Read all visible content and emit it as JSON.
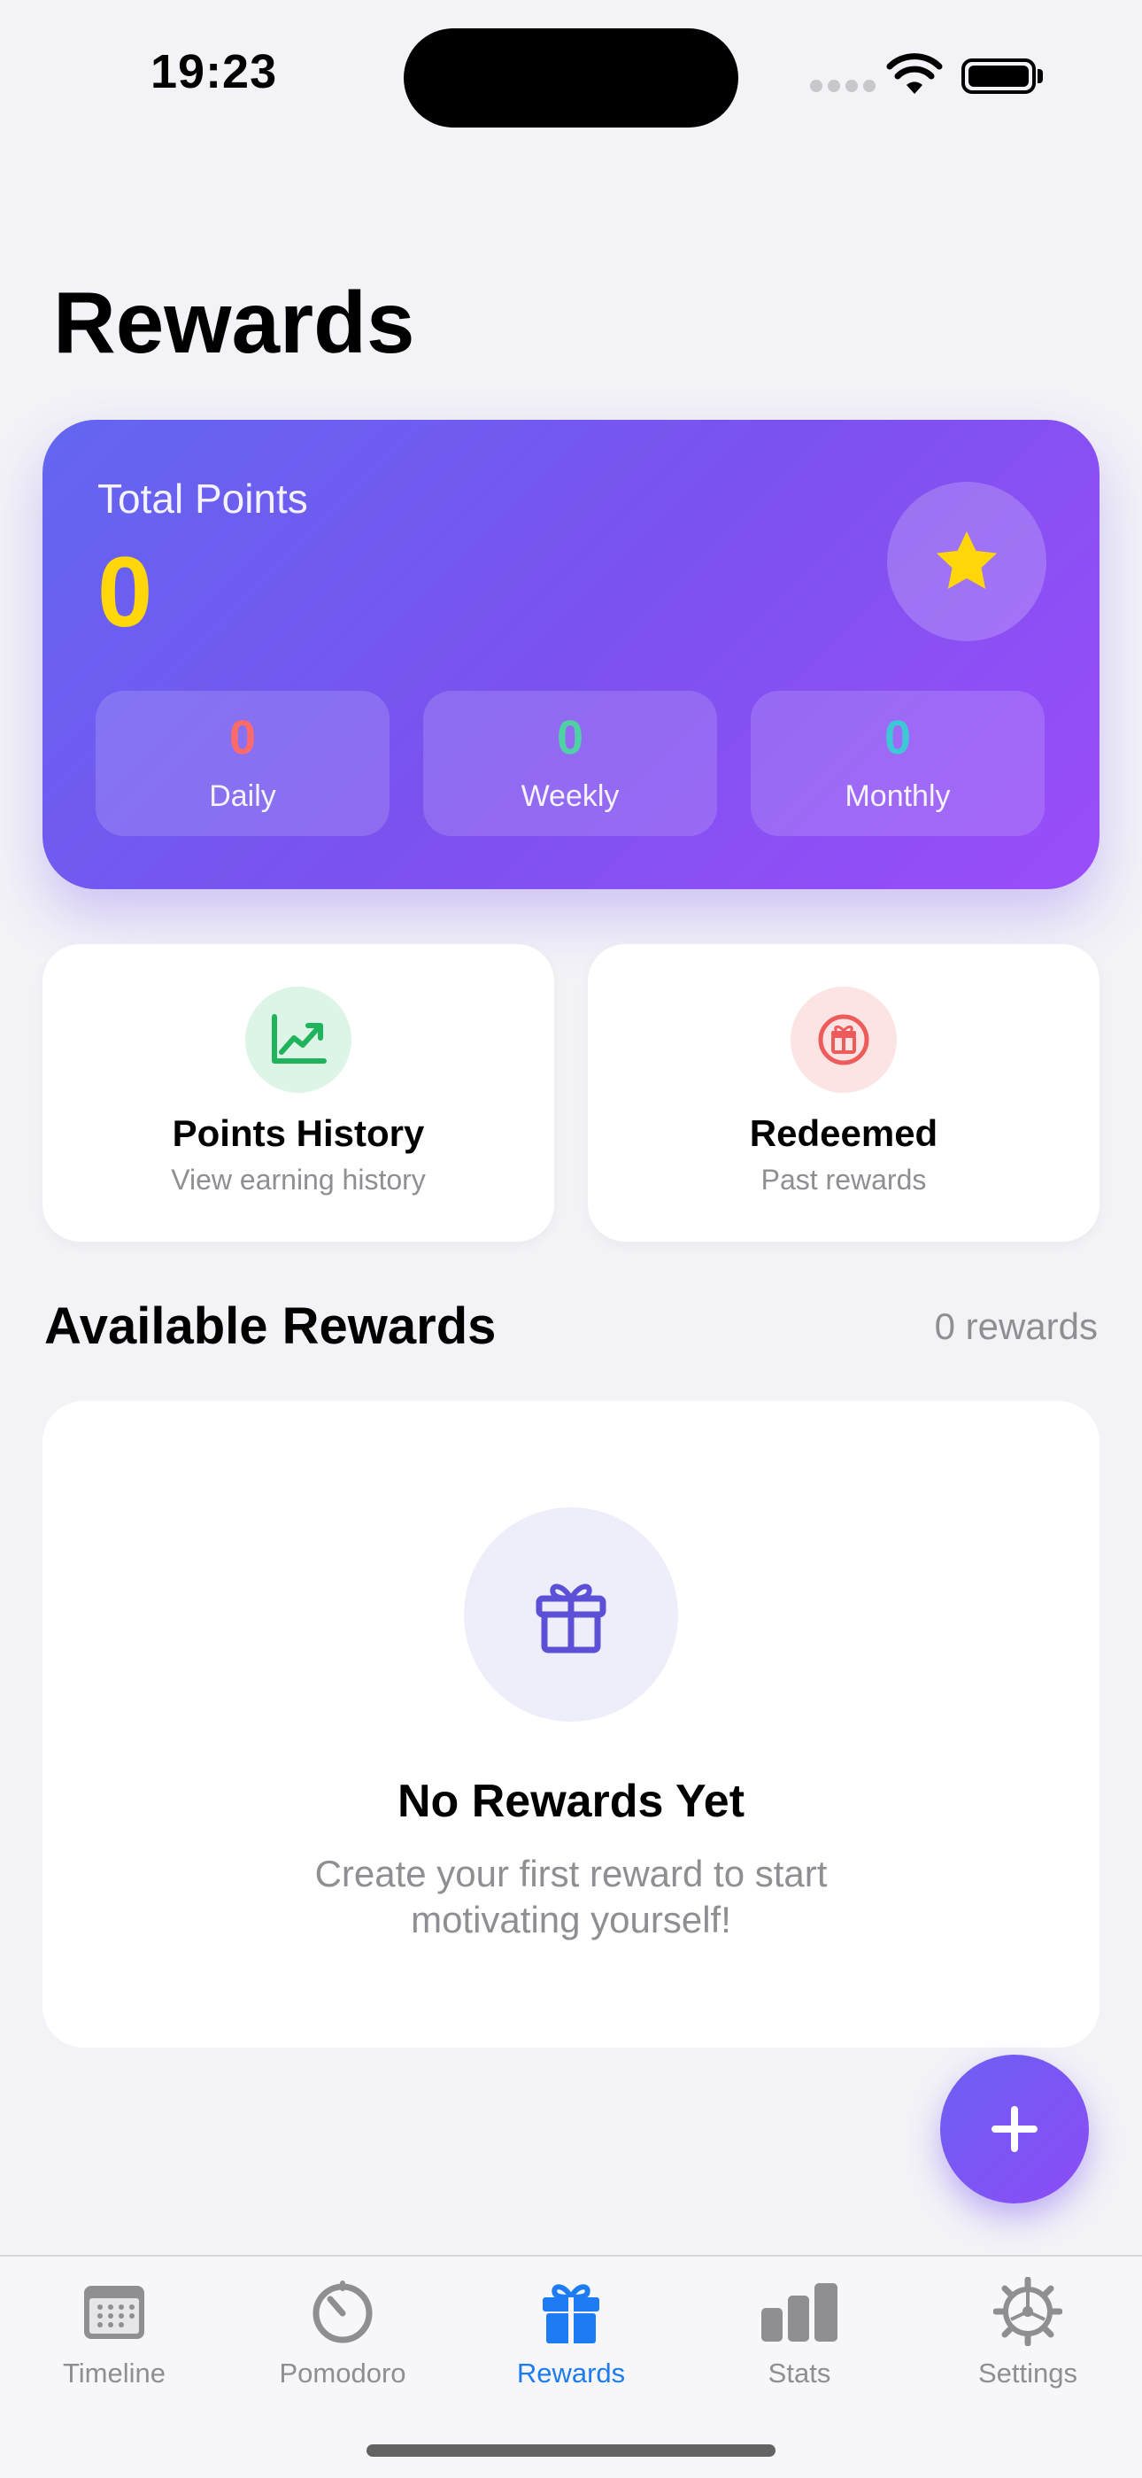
{
  "status_bar": {
    "time": "19:23"
  },
  "page": {
    "title": "Rewards"
  },
  "points_card": {
    "label": "Total Points",
    "total": "0",
    "stats": [
      {
        "value": "0",
        "label": "Daily",
        "color": "#ff6b6b"
      },
      {
        "value": "0",
        "label": "Weekly",
        "color": "#4fd1a5"
      },
      {
        "value": "0",
        "label": "Monthly",
        "color": "#3ec7d6"
      }
    ],
    "star_icon": "star-icon"
  },
  "actions": [
    {
      "title": "Points History",
      "subtitle": "View earning history",
      "icon": "chart-line-icon",
      "color": "#1fb35b",
      "bg": "#ddf5e6"
    },
    {
      "title": "Redeemed",
      "subtitle": "Past rewards",
      "icon": "gift-icon",
      "color": "#ee5b5b",
      "bg": "#fde4e4"
    }
  ],
  "available": {
    "title": "Available Rewards",
    "count": "0 rewards"
  },
  "empty_state": {
    "title": "No Rewards Yet",
    "description": "Create your first reward to start motivating yourself!",
    "icon": "gift-icon"
  },
  "fab": {
    "icon": "plus-icon"
  },
  "tabs": [
    {
      "label": "Timeline",
      "icon": "calendar-icon",
      "active": false
    },
    {
      "label": "Pomodoro",
      "icon": "timer-icon",
      "active": false
    },
    {
      "label": "Rewards",
      "icon": "gift-icon",
      "active": true
    },
    {
      "label": "Stats",
      "icon": "bar-chart-icon",
      "active": false
    },
    {
      "label": "Settings",
      "icon": "gear-icon",
      "active": false
    }
  ],
  "colors": {
    "accent": "#1e7cf2",
    "brand_start": "#6366f1",
    "brand_end": "#9b4dfa",
    "points": "#ffd60a"
  }
}
